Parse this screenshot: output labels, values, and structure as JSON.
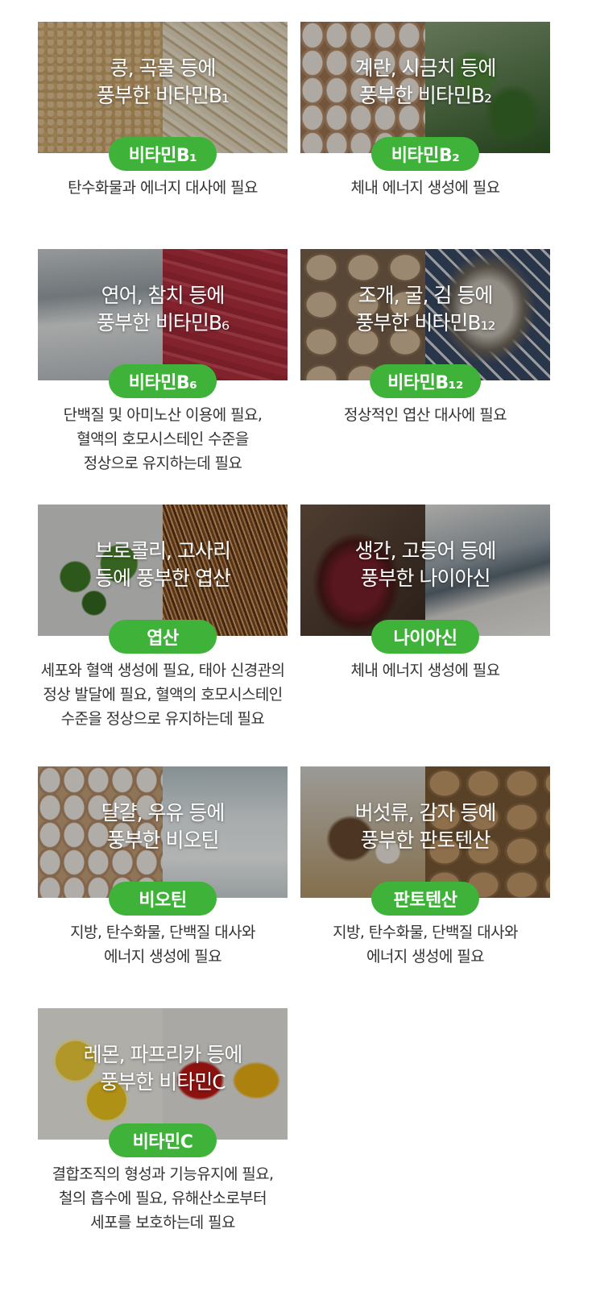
{
  "cards": [
    {
      "caption_line1": "콩, 곡물 등에",
      "caption_line2": "풍부한 비타민B₁",
      "badge": "비타민B₁",
      "desc": [
        "탄수화물과 에너지 대사에 필요"
      ]
    },
    {
      "caption_line1": "계란, 시금치 등에",
      "caption_line2": "풍부한 비타민B₂",
      "badge": "비타민B₂",
      "desc": [
        "체내 에너지 생성에 필요"
      ]
    },
    {
      "caption_line1": "연어, 참치 등에",
      "caption_line2": "풍부한 비타민B₆",
      "badge": "비타민B₆",
      "desc": [
        "단백질 및 아미노산 이용에 필요,",
        "혈액의 호모시스테인 수준을",
        "정상으로 유지하는데 필요"
      ]
    },
    {
      "caption_line1": "조개, 굴, 김 등에",
      "caption_line2": "풍부한 비타민B₁₂",
      "badge": "비타민B₁₂",
      "desc": [
        "정상적인 엽산 대사에 필요"
      ]
    },
    {
      "caption_line1": "브로콜리, 고사리",
      "caption_line2": "등에 풍부한 엽산",
      "badge": "엽산",
      "desc": [
        "세포와 혈액 생성에 필요, 태아 신경관의",
        "정상 발달에 필요, 혈액의 호모시스테인",
        "수준을 정상으로 유지하는데 필요"
      ]
    },
    {
      "caption_line1": "생간, 고등어 등에",
      "caption_line2": "풍부한 나이아신",
      "badge": "나이아신",
      "desc": [
        "체내 에너지 생성에 필요"
      ]
    },
    {
      "caption_line1": "달걀, 우유 등에",
      "caption_line2": "풍부한 비오틴",
      "badge": "비오틴",
      "desc": [
        "지방, 탄수화물, 단백질 대사와",
        "에너지 생성에 필요"
      ]
    },
    {
      "caption_line1": "버섯류, 감자 등에",
      "caption_line2": "풍부한 판토텐산",
      "badge": "판토텐산",
      "desc": [
        "지방, 탄수화물, 단백질 대사와",
        "에너지 생성에 필요"
      ]
    },
    {
      "caption_line1": "레몬, 파프리카 등에",
      "caption_line2": "풍부한 비타민C",
      "badge": "비타민C",
      "desc": [
        "결합조직의 형성과 기능유지에 필요,",
        "철의 흡수에 필요, 유해산소로부터",
        "세포를 보호하는데 필요"
      ]
    }
  ],
  "colors": {
    "badge": "#3fb23a",
    "text": "#333333"
  }
}
